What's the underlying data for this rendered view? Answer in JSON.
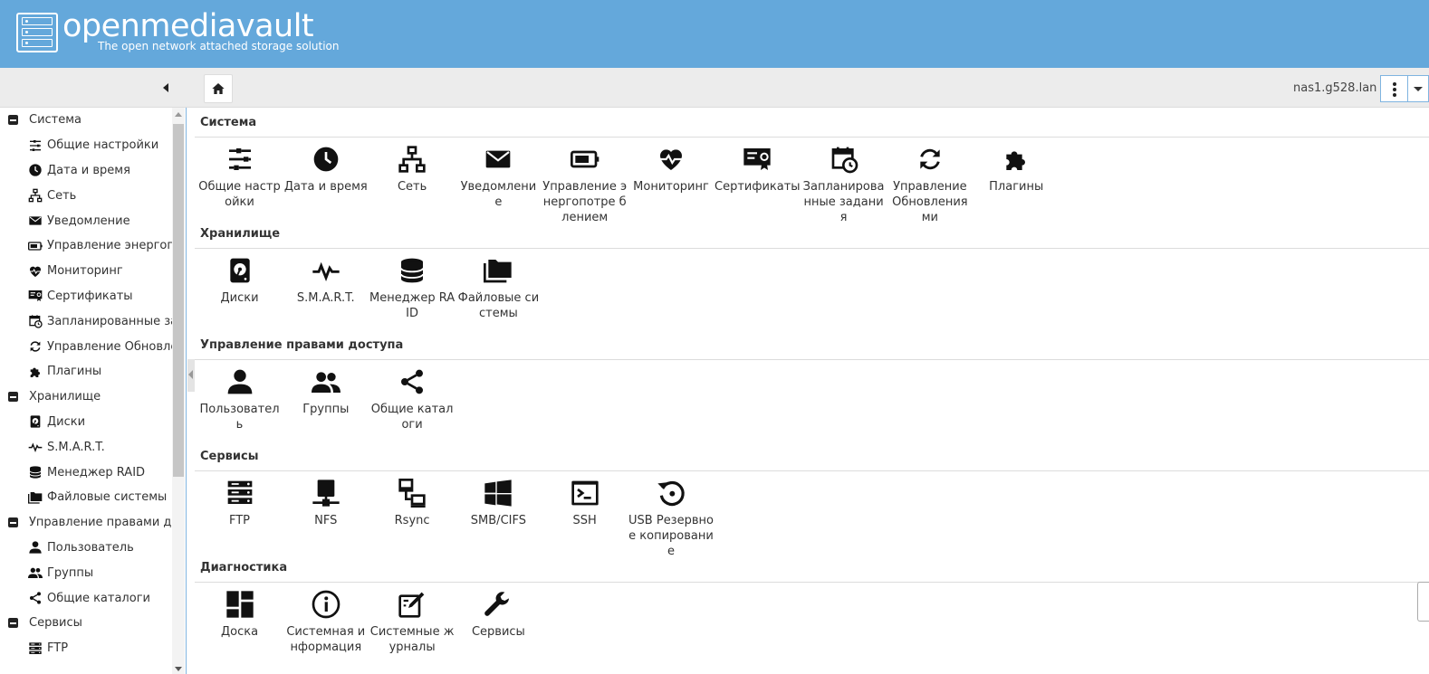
{
  "header": {
    "title": "openmediavault",
    "subtitle": "The open network attached storage solution"
  },
  "toolbar": {
    "hostname": "nas1.g528.lan"
  },
  "sidebar": {
    "groups": [
      {
        "label": "Система",
        "items": [
          {
            "label": "Общие настройки",
            "icon": "sliders-icon"
          },
          {
            "label": "Дата и время",
            "icon": "clock-icon"
          },
          {
            "label": "Сеть",
            "icon": "network-icon"
          },
          {
            "label": "Уведомление",
            "icon": "envelope-icon"
          },
          {
            "label": "Управление энергопо",
            "icon": "battery-icon"
          },
          {
            "label": "Мониторинг",
            "icon": "heart-pulse-icon"
          },
          {
            "label": "Сертификаты",
            "icon": "certificate-icon"
          },
          {
            "label": "Запланированные за,",
            "icon": "calendar-clock-icon"
          },
          {
            "label": "Управление Обновле",
            "icon": "sync-icon"
          },
          {
            "label": "Плагины",
            "icon": "puzzle-icon"
          }
        ]
      },
      {
        "label": "Хранилище",
        "items": [
          {
            "label": "Диски",
            "icon": "harddisk-icon"
          },
          {
            "label": "S.M.A.R.T.",
            "icon": "pulse-icon"
          },
          {
            "label": "Менеджер RAID",
            "icon": "database-icon"
          },
          {
            "label": "Файловые системы",
            "icon": "folders-icon"
          }
        ]
      },
      {
        "label": "Управление правами до",
        "items": [
          {
            "label": "Пользователь",
            "icon": "user-icon"
          },
          {
            "label": "Группы",
            "icon": "users-icon"
          },
          {
            "label": "Общие каталоги",
            "icon": "share-icon"
          }
        ]
      },
      {
        "label": "Сервисы",
        "items": [
          {
            "label": "FTP",
            "icon": "server-icon"
          }
        ]
      }
    ]
  },
  "dashboard": {
    "sections": [
      {
        "title": "Система",
        "tiles": [
          {
            "label": "Общие настройки",
            "icon": "sliders-icon"
          },
          {
            "label": "Дата и время",
            "icon": "clock-icon"
          },
          {
            "label": "Сеть",
            "icon": "network-icon"
          },
          {
            "label": "Уведомлени е",
            "icon": "envelope-icon"
          },
          {
            "label": "Управление энергопотре блением",
            "icon": "battery-icon"
          },
          {
            "label": "Мониторинг",
            "icon": "heart-pulse-icon"
          },
          {
            "label": "Сертификаты",
            "icon": "certificate-icon"
          },
          {
            "label": "Запланирова нные задания",
            "icon": "calendar-clock-icon"
          },
          {
            "label": "Управление Обновления ми",
            "icon": "sync-icon"
          },
          {
            "label": "Плагины",
            "icon": "puzzle-icon"
          }
        ]
      },
      {
        "title": "Хранилище",
        "tiles": [
          {
            "label": "Диски",
            "icon": "harddisk-icon"
          },
          {
            "label": "S.M.A.R.T.",
            "icon": "pulse-icon"
          },
          {
            "label": "Менеджер RAID",
            "icon": "database-icon"
          },
          {
            "label": "Файловые системы",
            "icon": "folders-icon"
          }
        ]
      },
      {
        "title": "Управление правами доступа",
        "tiles": [
          {
            "label": "Пользовател ь",
            "icon": "user-icon"
          },
          {
            "label": "Группы",
            "icon": "users-icon"
          },
          {
            "label": "Общие каталоги",
            "icon": "share-icon"
          }
        ]
      },
      {
        "title": "Сервисы",
        "tiles": [
          {
            "label": "FTP",
            "icon": "server-icon"
          },
          {
            "label": "NFS",
            "icon": "nfs-icon"
          },
          {
            "label": "Rsync",
            "icon": "rsync-icon"
          },
          {
            "label": "SMB/CIFS",
            "icon": "windows-icon"
          },
          {
            "label": "SSH",
            "icon": "terminal-icon"
          },
          {
            "label": "USB Резервное копирование",
            "icon": "backup-icon"
          }
        ]
      },
      {
        "title": "Диагностика",
        "tiles": [
          {
            "label": "Доска",
            "icon": "dashboard-icon"
          },
          {
            "label": "Системная информация",
            "icon": "info-icon"
          },
          {
            "label": "Системные журналы",
            "icon": "log-edit-icon"
          },
          {
            "label": "Сервисы",
            "icon": "wrench-icon"
          }
        ]
      }
    ]
  }
}
